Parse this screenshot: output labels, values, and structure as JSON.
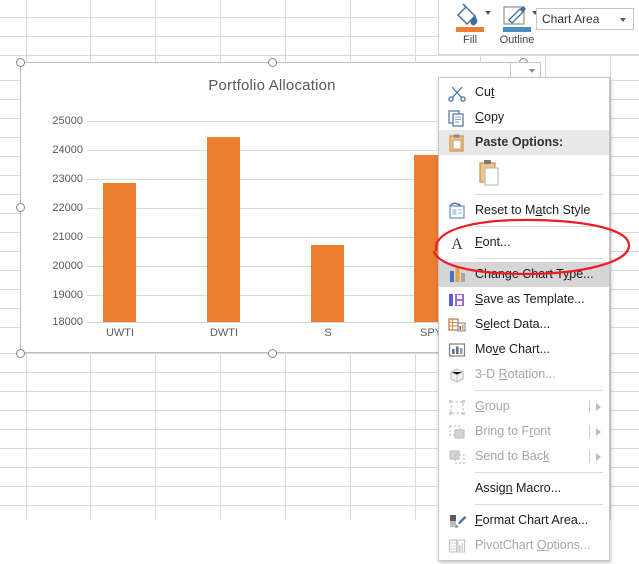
{
  "application": "Excel chart context menu",
  "ribbon": {
    "fill": {
      "label": "Fill",
      "icon": "fill-bucket-icon",
      "color": "#ed7d31"
    },
    "outline": {
      "label": "Outline",
      "icon": "outline-pencil-icon",
      "color": "#4a8ec2"
    },
    "chart_element_combo": {
      "value": "Chart Area",
      "icon": "chevron-down-icon"
    }
  },
  "chart": {
    "title": "Portfolio Allocation",
    "selected": true,
    "series_color": "#ed7d31"
  },
  "chart_data": {
    "type": "bar",
    "title": "Portfolio Allocation",
    "categories": [
      "UWTI",
      "DWTI",
      "S",
      "SPY"
    ],
    "values": [
      22850,
      24430,
      20680,
      23820
    ],
    "xlabel": "",
    "ylabel": "",
    "ylim": [
      18000,
      25000
    ],
    "yticks": [
      18000,
      19000,
      20000,
      21000,
      22000,
      23000,
      24000,
      25000
    ],
    "ytick_labels": [
      "18000",
      "19000",
      "20000",
      "21000",
      "22000",
      "23000",
      "24000",
      "25000"
    ],
    "grid": true,
    "legend": "none",
    "series": [
      {
        "name": "Portfolio Allocation",
        "color": "#ed7d31",
        "values": [
          22850,
          24430,
          20680,
          23820
        ]
      }
    ]
  },
  "context_menu": {
    "items": [
      {
        "id": "cut",
        "label": "Cut",
        "accel": "t",
        "icon": "scissors-icon",
        "state": "normal",
        "submenu": false
      },
      {
        "id": "copy",
        "label": "Copy",
        "accel": "C",
        "icon": "copy-icon",
        "state": "normal",
        "submenu": false
      },
      {
        "id": "paste-options",
        "label": "Paste Options:",
        "icon": "clipboard-icon",
        "state": "header",
        "submenu": false
      },
      {
        "id": "paste-gallery",
        "label": "",
        "icon": "paste-clipboard-icon",
        "state": "gallery",
        "submenu": false
      },
      {
        "id": "reset-to-match-style",
        "label": "Reset to Match Style",
        "accel": "a",
        "icon": "reset-style-icon",
        "state": "normal",
        "submenu": false
      },
      {
        "id": "font",
        "label": "Font...",
        "accel": "F",
        "icon": "font-a-icon",
        "state": "normal",
        "submenu": false
      },
      {
        "id": "change-chart-type",
        "label": "Change Chart Type...",
        "accel": "y",
        "icon": "bar-chart-icon",
        "state": "selected",
        "submenu": false
      },
      {
        "id": "save-as-template",
        "label": "Save as Template...",
        "accel": "S",
        "icon": "save-template-icon",
        "state": "normal",
        "submenu": false
      },
      {
        "id": "select-data",
        "label": "Select Data...",
        "accel": "e",
        "icon": "select-data-icon",
        "state": "normal",
        "submenu": false
      },
      {
        "id": "move-chart",
        "label": "Move Chart...",
        "accel": "v",
        "icon": "move-chart-icon",
        "state": "normal",
        "submenu": false
      },
      {
        "id": "3d-rotation",
        "label": "3-D Rotation...",
        "accel": "R",
        "icon": "cube-icon",
        "state": "disabled",
        "submenu": false
      },
      {
        "id": "group",
        "label": "Group",
        "accel": "G",
        "icon": "group-icon",
        "state": "disabled",
        "submenu": true
      },
      {
        "id": "bring-to-front",
        "label": "Bring to Front",
        "accel": "r",
        "icon": "bring-front-icon",
        "state": "disabled",
        "submenu": true
      },
      {
        "id": "send-to-back",
        "label": "Send to Back",
        "accel": "k",
        "icon": "send-back-icon",
        "state": "disabled",
        "submenu": true
      },
      {
        "id": "assign-macro",
        "label": "Assign Macro...",
        "accel": "n",
        "icon": "none",
        "state": "normal",
        "submenu": false
      },
      {
        "id": "format-chart-area",
        "label": "Format Chart Area...",
        "accel": "F",
        "icon": "format-paint-icon",
        "state": "normal",
        "submenu": false
      },
      {
        "id": "pivotchart-options",
        "label": "PivotChart Options...",
        "accel": "O",
        "icon": "pivotchart-icon",
        "state": "disabled",
        "submenu": false
      }
    ]
  },
  "annotation": {
    "shape": "red-ellipse",
    "color": "#ee1c24",
    "targets": "change-chart-type"
  }
}
